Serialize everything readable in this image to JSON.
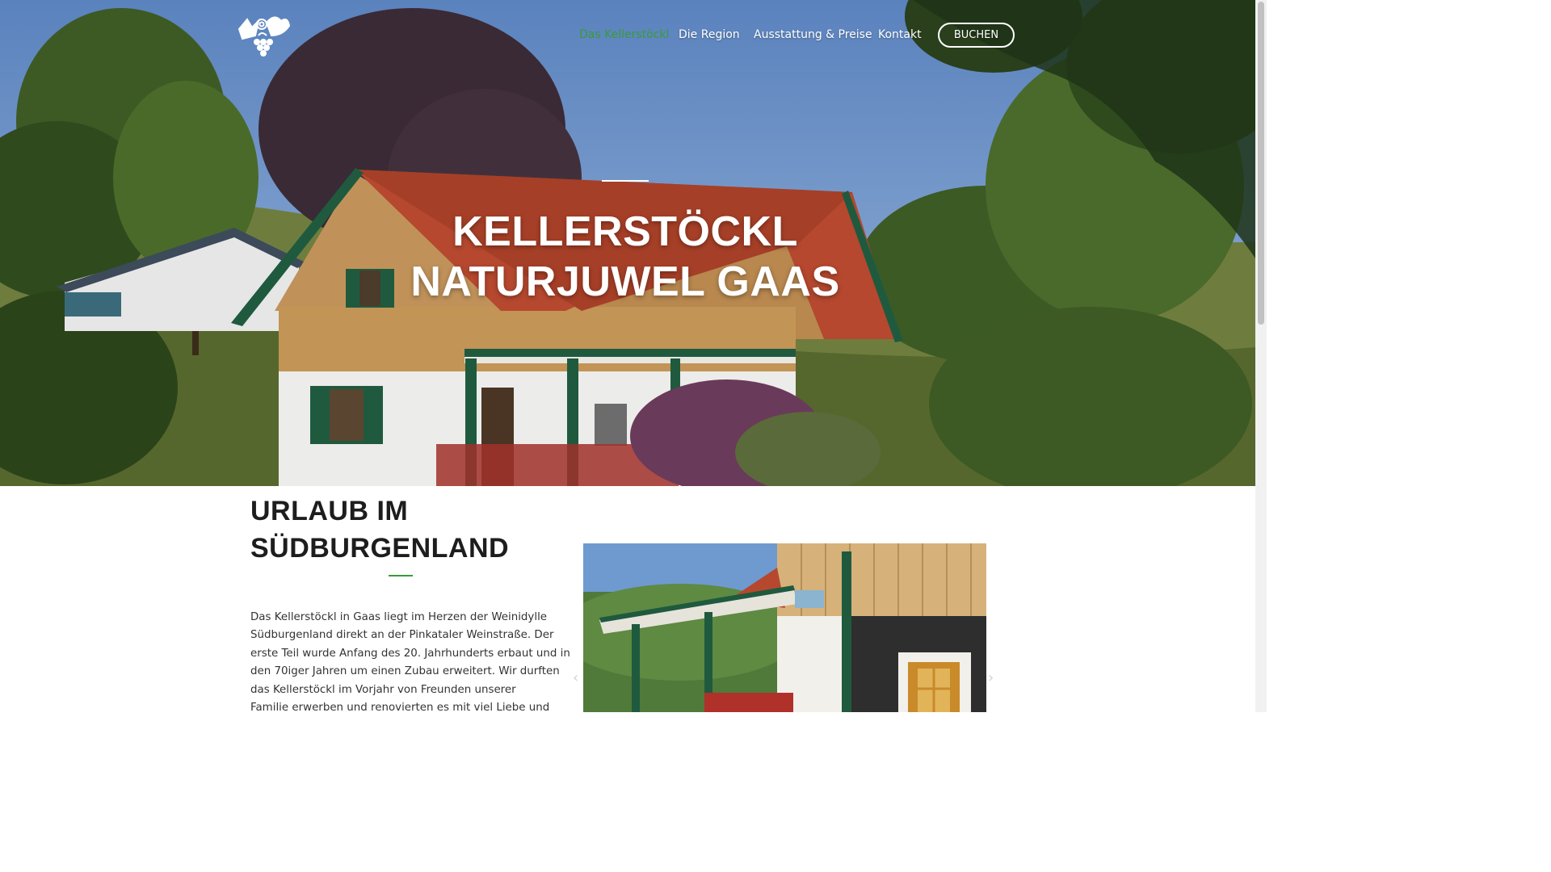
{
  "nav": {
    "items": [
      {
        "label": "Das Kellerstöckl",
        "active": true
      },
      {
        "label": "Die Region",
        "active": false
      },
      {
        "label": "Ausstattung & Preise",
        "active": false
      },
      {
        "label": "Kontakt",
        "active": false
      }
    ],
    "book_button": "BUCHEN",
    "logo_icon": "grape-vine-icon"
  },
  "hero": {
    "title_line1": "KELLERSTÖCKL",
    "title_line2": "NATURJUWEL GAAS"
  },
  "intro": {
    "title_line1": "URLAUB IM",
    "title_line2": "SÜDBURGENLAND",
    "paragraph_lines": [
      "Das Kellerstöckl in Gaas liegt im Herzen der Weinidylle",
      "Südburgenland direkt an der Pinkataler Weinstraße. Der",
      "erste Teil wurde Anfang des 20. Jahrhunderts erbaut und in",
      "den 70iger Jahren um einen Zubau erweitert. Wir durften",
      "das Kellerstöckl im Vorjahr von Freunden unserer",
      "Familie erwerben und renovierten es mit viel Liebe und"
    ]
  },
  "gallery": {
    "prev_icon": "chevron-left-icon",
    "next_icon": "chevron-right-icon",
    "prev_glyph": "‹",
    "next_glyph": "›"
  },
  "colors": {
    "accent_green": "#3a9a3a",
    "roof_red": "#b5482e",
    "trim_green": "#1f5a3f",
    "wood": "#c89a5e"
  }
}
